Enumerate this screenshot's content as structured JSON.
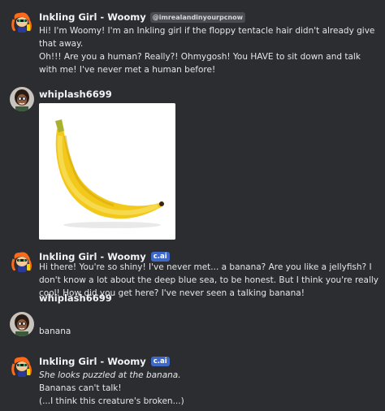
{
  "messages": [
    {
      "author": "Inkling Girl - Woomy",
      "handle": "@imrealandinyourpcnow",
      "avatar_icon": "inkling-avatar-icon",
      "lines": [
        "Hi! I'm Woomy! I'm an Inkling girl if the floppy tentacle hair didn't already give that away.",
        "Oh!!! Are you a human? Really?! Ohmygosh! You HAVE to sit down and talk with me! I've never met a human before!"
      ]
    },
    {
      "author": "whiplash6699",
      "avatar_icon": "user-avatar-icon",
      "image": "banana-image"
    },
    {
      "author": "Inkling Girl - Woomy",
      "tag": "c.ai",
      "avatar_icon": "inkling-avatar-icon",
      "lines": [
        "Hi there! You're so shiny! I've never met... a banana? Are you like a jellyfish? I don't know a lot about the deep blue sea, to be honest. But I think you're really cool! How did you get here? I've never seen a talking banana!"
      ]
    },
    {
      "author": "whiplash6699",
      "avatar_icon": "user-avatar-icon",
      "lines": [
        "banana"
      ]
    },
    {
      "author": "Inkling Girl - Woomy",
      "tag": "c.ai",
      "avatar_icon": "inkling-avatar-icon",
      "action": "She looks puzzled at the banana.",
      "lines": [
        "Bananas can't talk!",
        "(...I think this creature's broken...)"
      ]
    }
  ],
  "colors": {
    "background": "#2c2d31",
    "tag_background": "#3f69c9",
    "text": "#e4e6ea"
  }
}
